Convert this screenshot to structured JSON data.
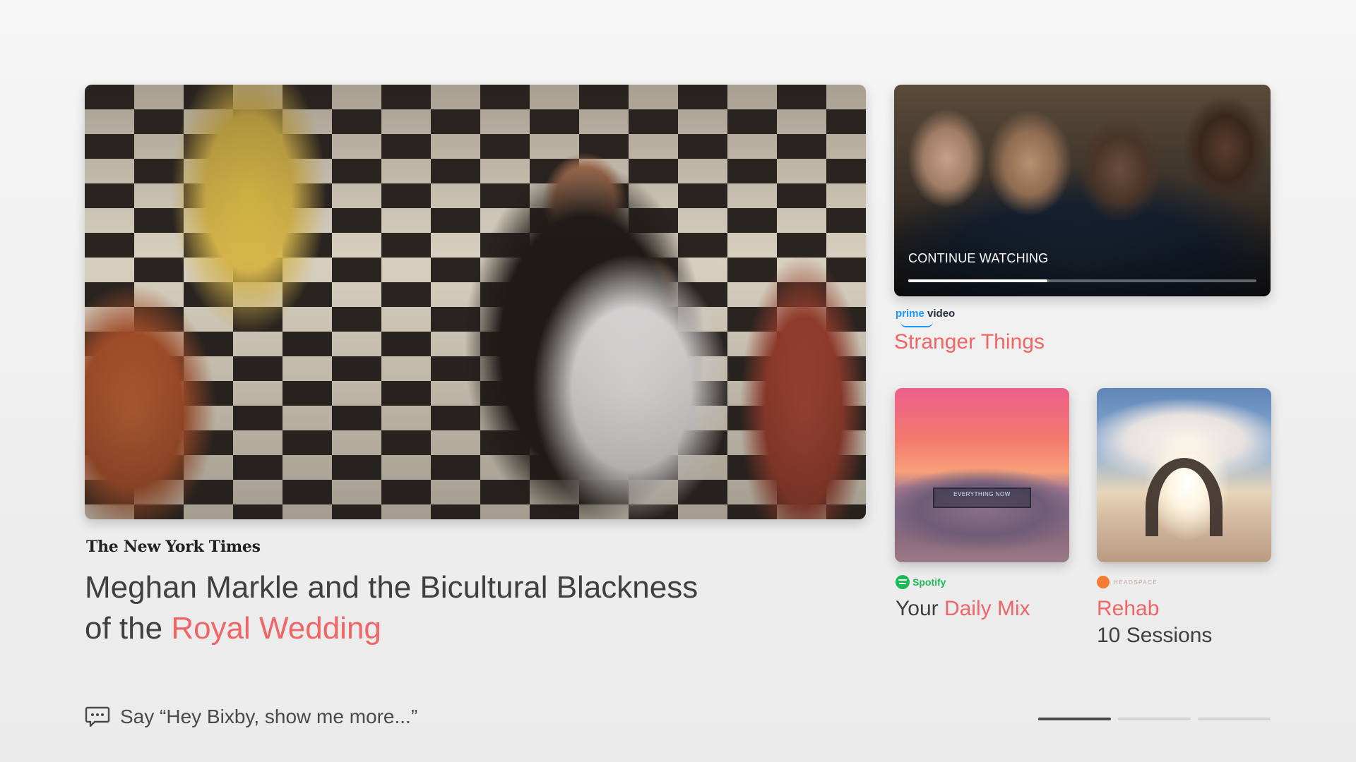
{
  "hero": {
    "publisher": "The New York Times",
    "headline_part1": "Meghan Markle and the Bicultural Blackness",
    "headline_part2_prefix": "of the ",
    "headline_part2_accent": "Royal Wedding"
  },
  "continue_watching": {
    "label": "CONTINUE WATCHING",
    "progress": 0.4,
    "provider_prime": "prime",
    "provider_video": "video",
    "title": "Stranger Things"
  },
  "spotify": {
    "provider": "Spotify",
    "billboard_text": "EVERYTHING NOW",
    "title_prefix": "Your ",
    "title_accent": "Daily Mix"
  },
  "headspace": {
    "provider": "HEADSPACE",
    "title": "Rehab",
    "subtitle": "10 Sessions"
  },
  "bixby": {
    "hint": "Say “Hey Bixby, show me more...”"
  },
  "pager": {
    "pages": 3,
    "active_index": 0
  },
  "colors": {
    "accent": "#f06565",
    "spotify_green": "#1db954",
    "prime_blue": "#1a98ff",
    "headspace_orange": "#f47d31"
  },
  "icons": {
    "bixby": "chat-bubble-icon",
    "spotify": "spotify-logo-icon",
    "headspace": "headspace-dot-icon"
  }
}
